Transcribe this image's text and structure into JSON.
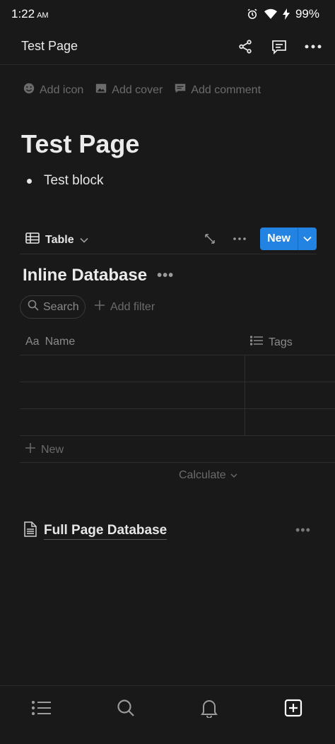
{
  "status_bar": {
    "time": "1:22",
    "ampm": "AM",
    "battery": "99%"
  },
  "header": {
    "title": "Test Page"
  },
  "page_options": {
    "add_icon": "Add icon",
    "add_cover": "Add cover",
    "add_comment": "Add comment"
  },
  "page": {
    "title": "Test Page",
    "bullet_text": "Test block"
  },
  "database": {
    "view_label": "Table",
    "new_label": "New",
    "title": "Inline Database",
    "search_label": "Search",
    "add_filter_label": "Add filter",
    "columns": [
      "Name",
      "Tags"
    ],
    "name_prefix": "Aa",
    "new_row_label": "New",
    "calculate_label": "Calculate"
  },
  "full_page_db": {
    "label": "Full Page Database"
  },
  "colors": {
    "background": "#191919",
    "accent": "#2383e2",
    "text": "#e6e6e6",
    "muted": "#6b6b6b"
  }
}
